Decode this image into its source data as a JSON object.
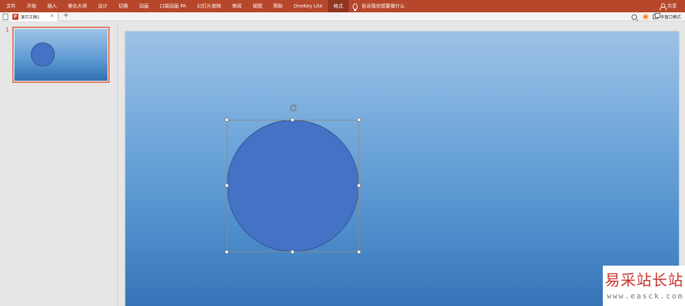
{
  "ribbon": {
    "tabs": [
      {
        "label": "文件"
      },
      {
        "label": "开始"
      },
      {
        "label": "插入"
      },
      {
        "label": "美化大师"
      },
      {
        "label": "设计"
      },
      {
        "label": "切换"
      },
      {
        "label": "动画"
      },
      {
        "label": "口袋动画 PA"
      },
      {
        "label": "幻灯片放映"
      },
      {
        "label": "审阅"
      },
      {
        "label": "视图"
      },
      {
        "label": "帮助"
      },
      {
        "label": "OneKey Lite"
      },
      {
        "label": "格式"
      }
    ],
    "active_tab": "格式",
    "tell_me": "告诉我你想要做什么",
    "share": "共享",
    "accent_color": "#b7472a"
  },
  "tabstrip": {
    "file_tab_icon": "P",
    "file_tab_name": "演示文稿1",
    "close_glyph": "×",
    "separator": "|",
    "add_glyph": "+",
    "multi_window": "多窗口模式"
  },
  "thumbnails": [
    {
      "number": "1",
      "selected": true
    }
  ],
  "slide": {
    "background": [
      "#9dc2e6",
      "#3372b5"
    ],
    "shape": {
      "type": "circle",
      "fill": "#4472c4",
      "outline": "#2f528f",
      "selected": true
    }
  },
  "watermark": {
    "title": "易采站长站",
    "url": "www.easck.com"
  }
}
